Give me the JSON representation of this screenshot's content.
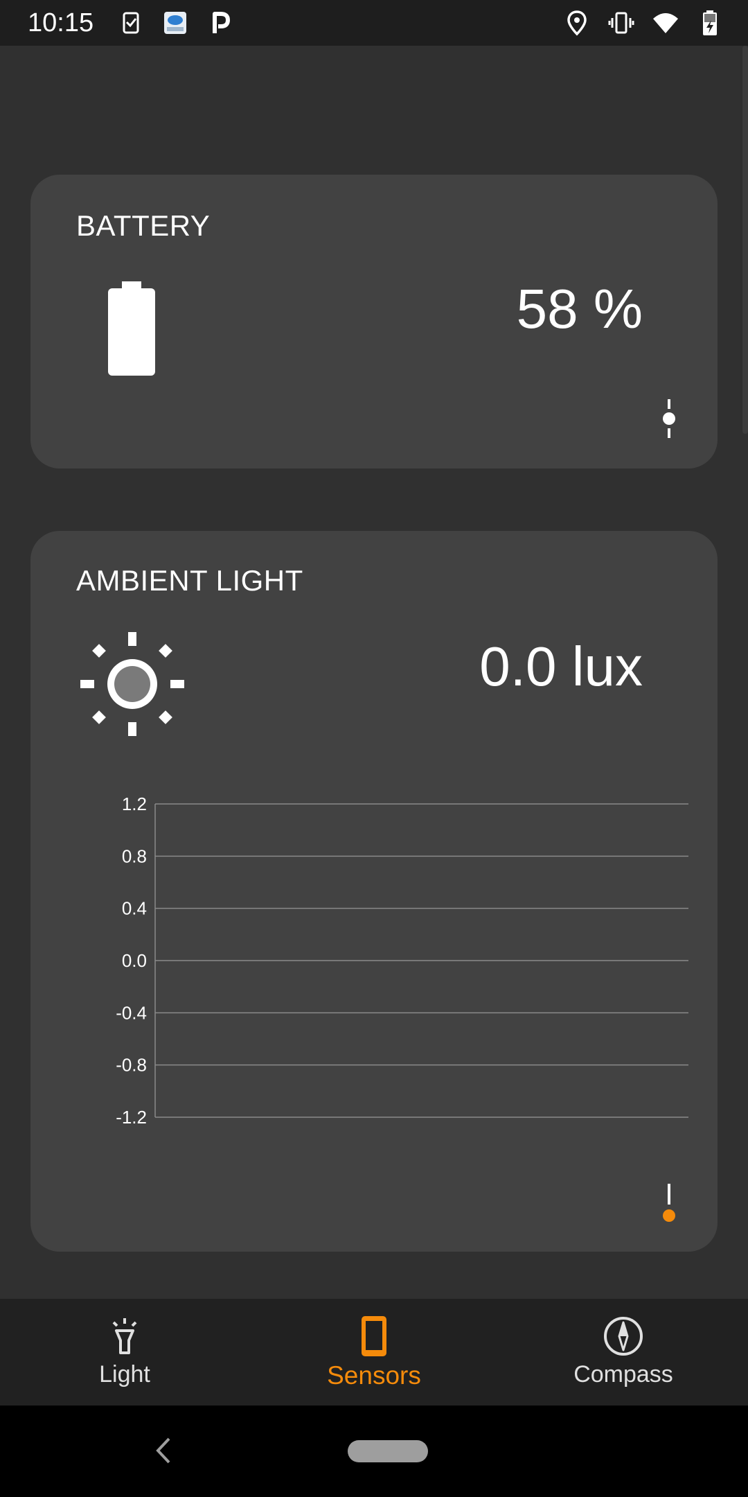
{
  "status_bar": {
    "time": "10:15",
    "left_icons": [
      "task-check-icon",
      "weather-app-icon",
      "parking-app-icon"
    ],
    "right_icons": [
      "location-icon",
      "vibrate-icon",
      "wifi-icon",
      "battery-charging-icon"
    ]
  },
  "battery_card": {
    "title": "BATTERY",
    "value": "58 %",
    "icon": "battery-icon",
    "level_fraction": 0.58
  },
  "ambient_light_card": {
    "title": "AMBIENT LIGHT",
    "value": "0.0 lux",
    "icon": "sun-icon"
  },
  "chart_data": {
    "type": "line",
    "title": "",
    "xlabel": "",
    "ylabel": "",
    "ylim": [
      -1.2,
      1.2
    ],
    "y_ticks": [
      "1.2",
      "0.8",
      "0.4",
      "0.0",
      "-0.4",
      "-0.8",
      "-1.2"
    ],
    "grid": true,
    "series": []
  },
  "colors": {
    "accent": "#f58b0b",
    "background": "#303030",
    "card": "#424242",
    "nav_background": "#212121"
  },
  "bottom_nav": {
    "items": [
      {
        "label": "Light",
        "icon": "flashlight-icon",
        "active": false
      },
      {
        "label": "Sensors",
        "icon": "phone-icon",
        "active": true
      },
      {
        "label": "Compass",
        "icon": "compass-icon",
        "active": false
      }
    ]
  }
}
